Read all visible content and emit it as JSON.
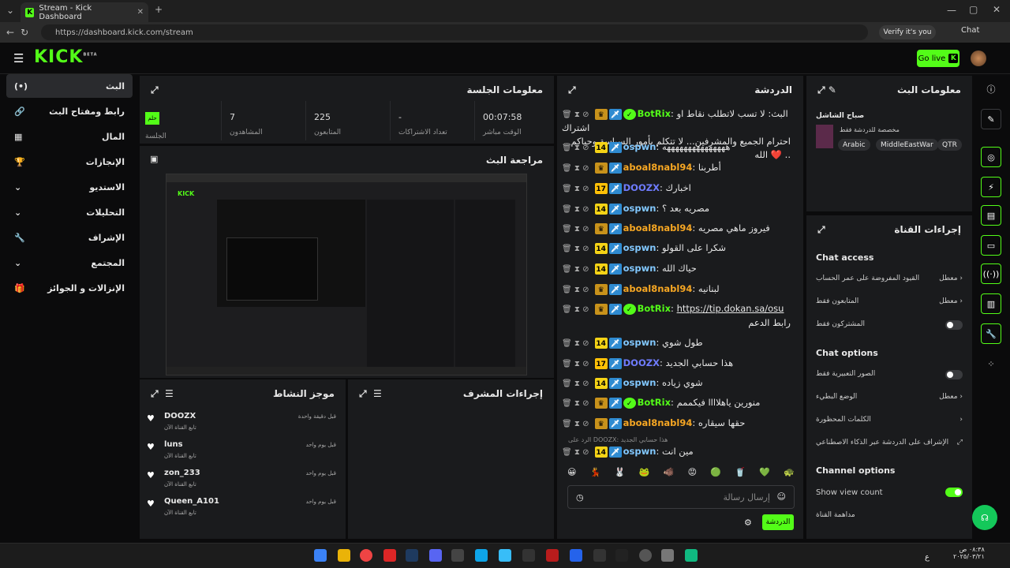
{
  "browser": {
    "tab_title": "Stream - Kick Dashboard",
    "url": "https://dashboard.kick.com/stream",
    "verify": "Verify it's you",
    "chat_btn": "Chat"
  },
  "header": {
    "logo": "KICK",
    "beta": "BETA",
    "go_live": "Go live"
  },
  "sidebar": {
    "items": [
      "البث",
      "رابط ومفتاح البث",
      "المال",
      "الإنجازات",
      "الاستديو",
      "التحليلات",
      "الإشراف",
      "المجتمع",
      "الإنزالات و الجوائز"
    ]
  },
  "session": {
    "title": "معلومات الجلسة",
    "live_badge": "حلم",
    "session_label": "الجلسة",
    "stats": [
      {
        "value": "7",
        "label": "المشاهدون"
      },
      {
        "value": "225",
        "label": "المتابعون"
      },
      {
        "value": "-",
        "label": "تعداد الاشتراكات"
      },
      {
        "value": "00:07:58",
        "label": "الوقت مباشر"
      }
    ]
  },
  "preview": {
    "title": "مراجعة البث"
  },
  "activity": {
    "title": "موجز النشاط",
    "items": [
      {
        "name": "DOOZX",
        "sub": "تابع القناة الآن",
        "time": "قبل دقيقة واحدة"
      },
      {
        "name": "luns",
        "sub": "تابع القناة الآن",
        "time": "قبل يوم واحد"
      },
      {
        "name": "zon_233",
        "sub": "تابع القناة الآن",
        "time": "قبل يوم واحد"
      },
      {
        "name": "Queen_A101",
        "sub": "تابع القناة الآن",
        "time": "قبل يوم واحد"
      }
    ]
  },
  "modactions": {
    "title": "إجراءات المشرف"
  },
  "chat": {
    "title": "الدردشة",
    "messages": [
      {
        "user": "BotRix",
        "color": "#53fc18",
        "text": "البث: لا تسب لاتطلب نقاط او اشتراك",
        "text2": "احترام الجميع والمشرفين... لا تتكلم بأمور السياسة,وحياكم الله ❤️ ..",
        "type": "bot"
      },
      {
        "user": "ospwn",
        "color": "#82c8ff",
        "text": "هههههههههههههههه",
        "type": "14"
      },
      {
        "user": "aboal8nabl94",
        "color": "#f5a623",
        "text": "أطربنا",
        "type": "crown"
      },
      {
        "user": "DOOZX",
        "color": "#6f7cff",
        "text": "اخبارك",
        "type": "17"
      },
      {
        "user": "ospwn",
        "color": "#82c8ff",
        "text": "مصريه بعد ؟",
        "type": "14"
      },
      {
        "user": "aboal8nabl94",
        "color": "#f5a623",
        "text": "فيروز ماهي مصريه",
        "type": "crown"
      },
      {
        "user": "ospwn",
        "color": "#82c8ff",
        "text": "شكرا على القولو",
        "type": "14"
      },
      {
        "user": "ospwn",
        "color": "#82c8ff",
        "text": "حياك الله",
        "type": "14"
      },
      {
        "user": "aboal8nabl94",
        "color": "#f5a623",
        "text": "لبنانيه",
        "type": "crown"
      },
      {
        "user": "BotRix",
        "color": "#53fc18",
        "text": "https://tip.dokan.sa/osu",
        "text2": "رابط الدعم",
        "type": "bot"
      },
      {
        "user": "ospwn",
        "color": "#82c8ff",
        "text": "طول شوي",
        "type": "14"
      },
      {
        "user": "DOOZX",
        "color": "#6f7cff",
        "text": "هذا حسابي الجديد",
        "type": "17"
      },
      {
        "user": "ospwn",
        "color": "#82c8ff",
        "text": "شوي زياده",
        "type": "14"
      },
      {
        "user": "BotRix",
        "color": "#53fc18",
        "text": "منورين ياهلاااا فيكممم",
        "type": "bot"
      },
      {
        "user": "aboal8nabl94",
        "color": "#f5a623",
        "text": "حقها سيقاره",
        "type": "crown"
      },
      {
        "user": "ospwn",
        "color": "#82c8ff",
        "text": "مين انت",
        "type": "14"
      }
    ],
    "reply_hint": "الرد على DOOZX: هذا حسابي الجديد",
    "input_placeholder": "إرسال رسالة",
    "send": "الدردشة"
  },
  "streaminfo": {
    "title": "معلومات البث",
    "stream_title": "صباح الشاشل",
    "category": "مخصصة للدردشة فقط",
    "tags": [
      "Arabic",
      "MiddleEastWar",
      "QTR"
    ]
  },
  "channel": {
    "title": "إجراءات القناة",
    "access_title": "Chat access",
    "access": [
      {
        "label": "القيود المفروضة على عمر الحساب",
        "val": "معطل"
      },
      {
        "label": "المتابعون فقط",
        "val": "معطل"
      },
      {
        "label": "المشتركون فقط",
        "val": ""
      }
    ],
    "options_title": "Chat options",
    "options": [
      {
        "label": "الصور التعبيرية فقط",
        "val": ""
      },
      {
        "label": "الوضع البطيء",
        "val": "معطل"
      },
      {
        "label": "الكلمات المحظورة",
        "val": ""
      },
      {
        "label": "الإشراف على الدردشة عبر الذكاء الاصطناعي",
        "val": ""
      }
    ],
    "channel_options_title": "Channel options",
    "show_view_count": "Show view count",
    "watch": "مداهمة القناة"
  },
  "taskbar": {
    "time": "٠٨:٣٨ ص",
    "date": "٢٠٢٥/٠٣/٢١",
    "lang": "ع"
  }
}
